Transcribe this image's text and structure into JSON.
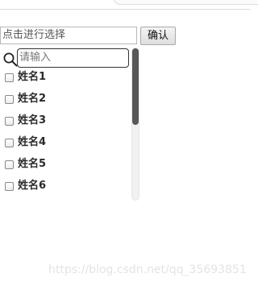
{
  "picker": {
    "value": "点击进行选择",
    "confirm_label": "确认"
  },
  "dropdown": {
    "search_placeholder": "请输入",
    "items": [
      {
        "label": "姓名1",
        "checked": false
      },
      {
        "label": "姓名2",
        "checked": false
      },
      {
        "label": "姓名3",
        "checked": false
      },
      {
        "label": "姓名4",
        "checked": false
      },
      {
        "label": "姓名5",
        "checked": false
      },
      {
        "label": "姓名6",
        "checked": false
      }
    ]
  },
  "icons": {
    "search": "search-icon"
  },
  "watermark": "https://blog.csdn.net/qq_35693851"
}
